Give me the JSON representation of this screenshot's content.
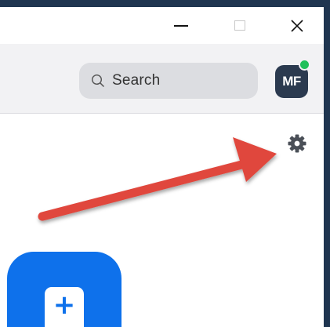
{
  "window_controls": {
    "minimize": "—",
    "maximize": "☐",
    "close": "✕"
  },
  "header": {
    "search": {
      "icon": "search-icon",
      "label": "Search"
    },
    "avatar": {
      "initials": "MF",
      "status": "online"
    }
  },
  "toolbar": {
    "settings_icon": "gear-icon"
  },
  "annotation": {
    "arrow_color": "#e0463c",
    "points_to": "settings"
  },
  "home": {
    "new_meeting_icon": "plus-icon",
    "accent_color": "#0e71eb"
  }
}
